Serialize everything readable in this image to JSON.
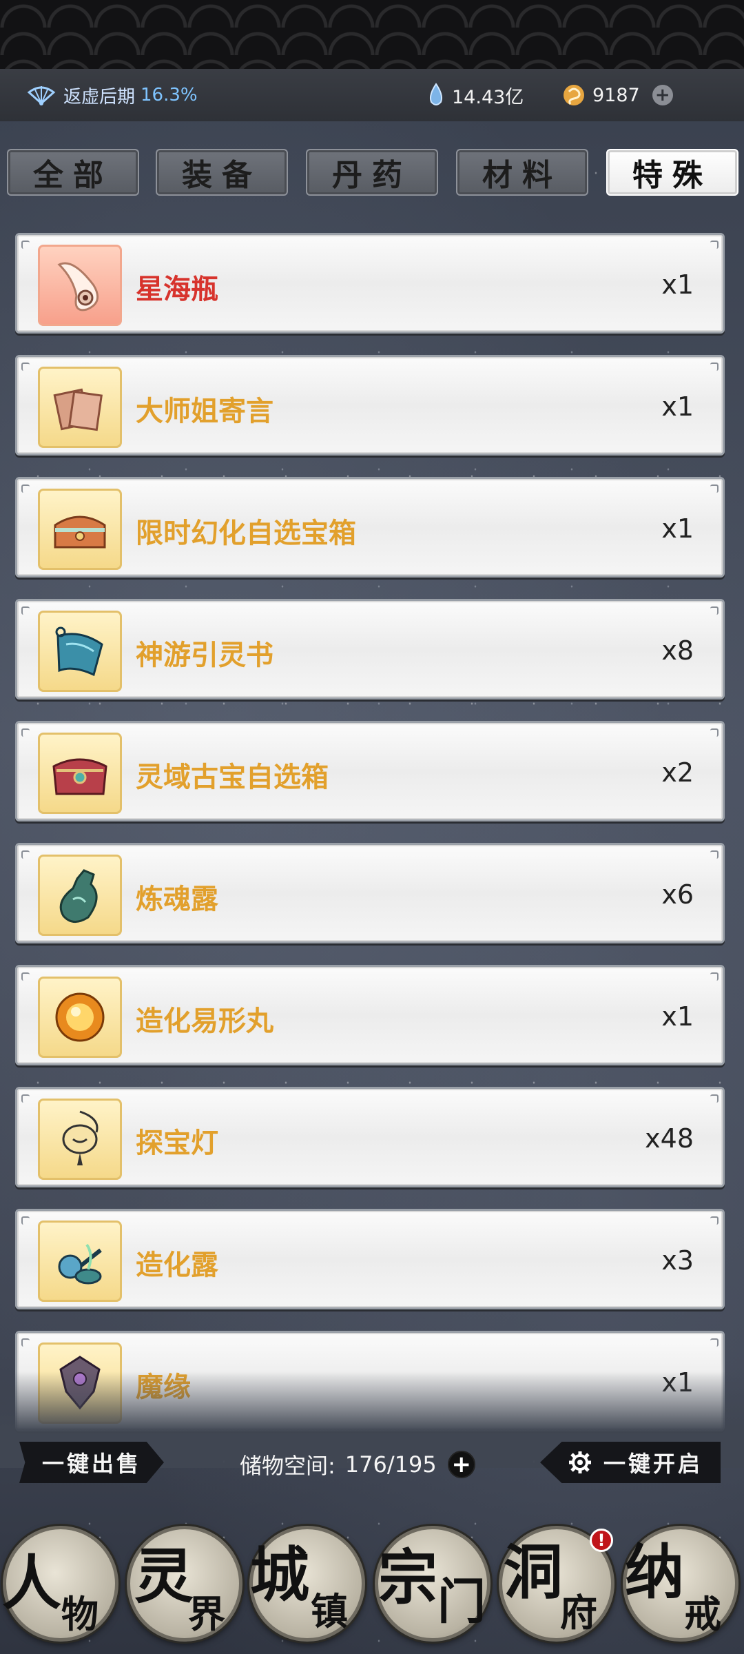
{
  "header": {
    "realm_label": "返虚后期",
    "realm_percent": "16.3%",
    "spirit_stones": "14.43亿",
    "jade": "9187"
  },
  "tabs": [
    {
      "label": "全部",
      "active": false
    },
    {
      "label": "装备",
      "active": false
    },
    {
      "label": "丹药",
      "active": false
    },
    {
      "label": "材料",
      "active": false
    },
    {
      "label": "特殊",
      "active": true
    }
  ],
  "items": [
    {
      "name": "星海瓶",
      "qty": "x1",
      "icon": "star-sea-bottle-icon"
    },
    {
      "name": "大师姐寄言",
      "qty": "x1",
      "icon": "letter-scroll-icon"
    },
    {
      "name": "限时幻化自选宝箱",
      "qty": "x1",
      "icon": "treasure-chest-icon"
    },
    {
      "name": "神游引灵书",
      "qty": "x8",
      "icon": "spirit-scroll-icon"
    },
    {
      "name": "灵域古宝自选箱",
      "qty": "x2",
      "icon": "ancient-chest-icon"
    },
    {
      "name": "炼魂露",
      "qty": "x6",
      "icon": "soul-dew-icon"
    },
    {
      "name": "造化易形丸",
      "qty": "x1",
      "icon": "golden-pill-icon"
    },
    {
      "name": "探宝灯",
      "qty": "x48",
      "icon": "treasure-lamp-icon"
    },
    {
      "name": "造化露",
      "qty": "x3",
      "icon": "creation-dew-icon"
    },
    {
      "name": "魔缘",
      "qty": "x1",
      "icon": "demon-fate-icon"
    }
  ],
  "bottom": {
    "sell_all": "一键出售",
    "storage_label": "储物空间:",
    "storage_value": "176/195",
    "open_all": "一键开启"
  },
  "nav": [
    {
      "c1": "人",
      "c2": "物"
    },
    {
      "c1": "灵",
      "c2": "界"
    },
    {
      "c1": "城",
      "c2": "镇"
    },
    {
      "c1": "宗",
      "c2": "门"
    },
    {
      "c1": "洞",
      "c2": "府",
      "badge": "!"
    },
    {
      "c1": "纳",
      "c2": "戒"
    }
  ],
  "colors": {
    "rare_name": "#d7332c",
    "epic_name": "#e2a02c",
    "active_tab": "#ffffff"
  }
}
